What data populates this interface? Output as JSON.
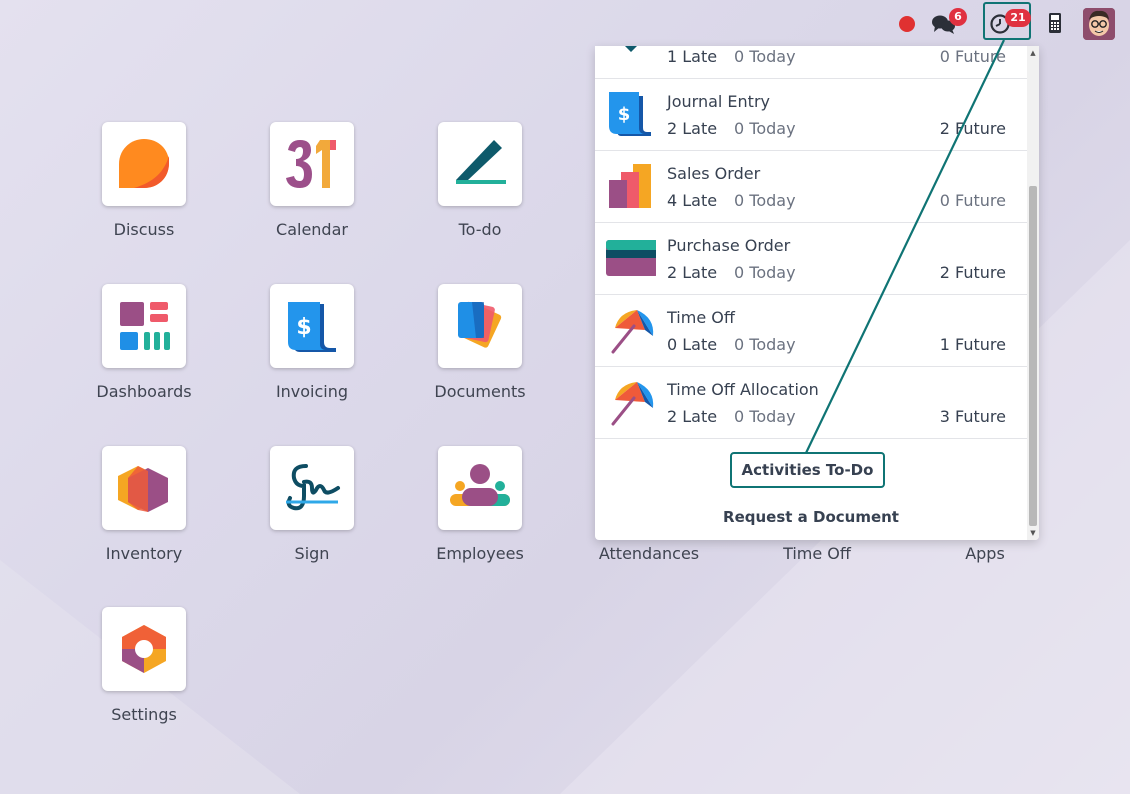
{
  "topbar": {
    "chat_badge": "6",
    "activity_badge": "21"
  },
  "apps": [
    {
      "label": "Discuss"
    },
    {
      "label": "Calendar",
      "icon_text": "31"
    },
    {
      "label": "To-do"
    },
    {
      "label": "Dashboards"
    },
    {
      "label": "Invoicing"
    },
    {
      "label": "Documents"
    },
    {
      "label": "Inventory"
    },
    {
      "label": "Sign"
    },
    {
      "label": "Employees"
    },
    {
      "label": "Attendances"
    },
    {
      "label": "Time Off"
    },
    {
      "label": "Apps"
    },
    {
      "label": "Settings"
    }
  ],
  "activities": {
    "rows": [
      {
        "name": "",
        "late": "1 Late",
        "today": "0 Today",
        "future": "0 Future"
      },
      {
        "name": "Journal Entry",
        "late": "2 Late",
        "today": "0 Today",
        "future": "2 Future"
      },
      {
        "name": "Sales Order",
        "late": "4 Late",
        "today": "0 Today",
        "future": "0 Future"
      },
      {
        "name": "Purchase Order",
        "late": "2 Late",
        "today": "0 Today",
        "future": "2 Future"
      },
      {
        "name": "Time Off",
        "late": "0 Late",
        "today": "0 Today",
        "future": "1 Future"
      },
      {
        "name": "Time Off Allocation",
        "late": "2 Late",
        "today": "0 Today",
        "future": "3 Future"
      }
    ],
    "todo_button": "Activities To-Do",
    "request_document": "Request a Document"
  },
  "colors": {
    "accent_teal": "#0f7474",
    "badge_red": "#e03140"
  }
}
